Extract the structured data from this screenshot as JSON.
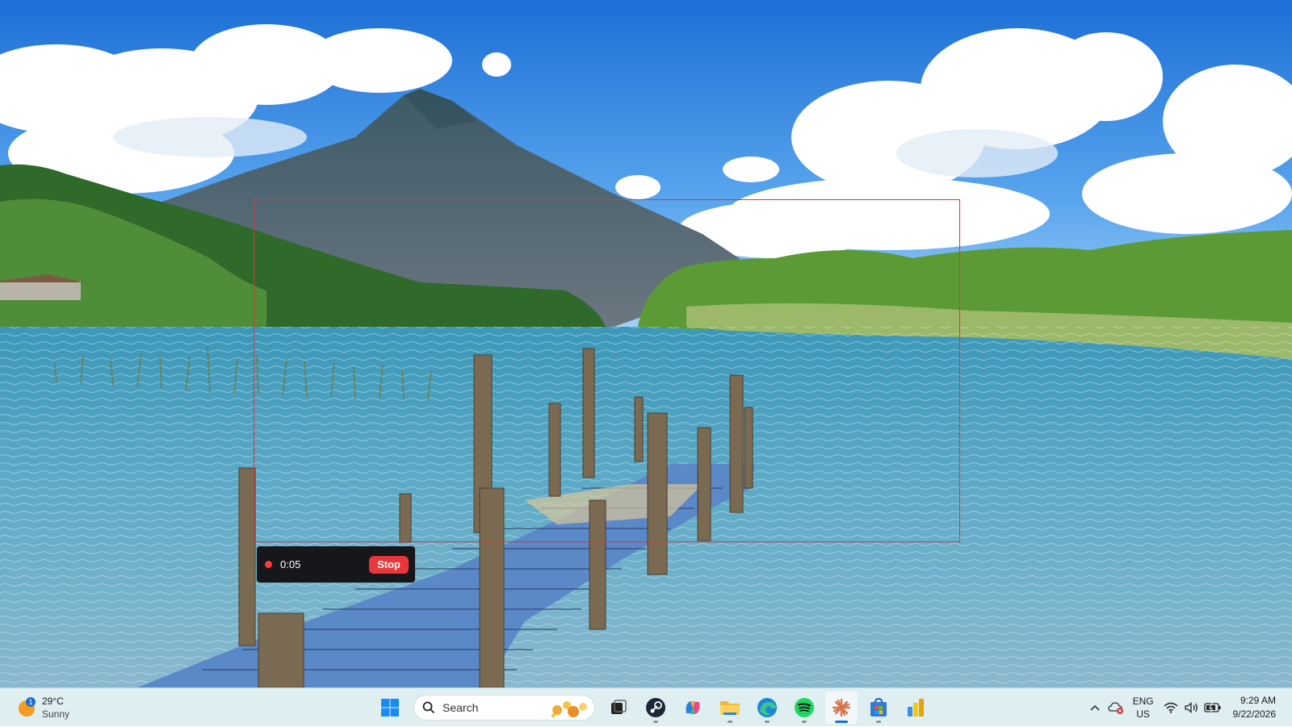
{
  "recording": {
    "elapsed": "0:05",
    "stop_label": "Stop",
    "region_color": "#e5323b"
  },
  "taskbar": {
    "weather": {
      "temperature": "29°C",
      "condition": "Sunny",
      "badge": "1",
      "icon": "sun-icon"
    },
    "search": {
      "label": "Search"
    },
    "pinned": [
      {
        "name": "start-icon"
      },
      {
        "name": "task-view-icon"
      },
      {
        "name": "steam-icon"
      },
      {
        "name": "copilot-icon"
      },
      {
        "name": "file-explorer-icon"
      },
      {
        "name": "edge-icon"
      },
      {
        "name": "spotify-icon"
      },
      {
        "name": "claude-icon"
      },
      {
        "name": "store-icon"
      },
      {
        "name": "power-bi-icon"
      }
    ],
    "tray": {
      "language": "ENG",
      "region": "US",
      "time": "9:29 AM",
      "date": "9/22/2026"
    },
    "accent": "#1c6fd1"
  }
}
